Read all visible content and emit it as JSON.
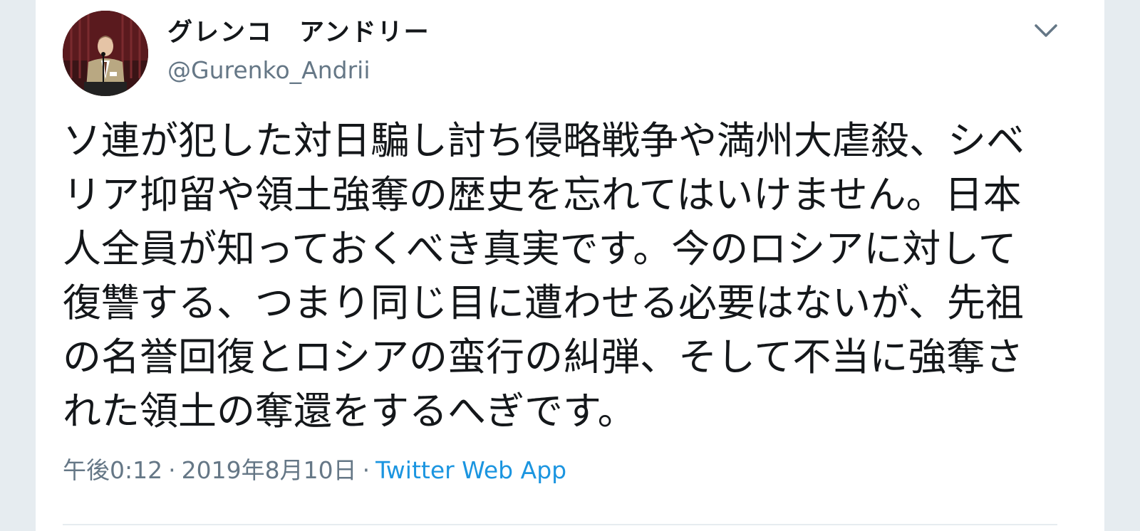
{
  "tweet": {
    "author": {
      "display_name": "グレンコ　アンドリー",
      "handle": "@Gurenko_Andrii"
    },
    "menu_icon": "chevron-down-icon",
    "avatar_icon": "profile-photo",
    "text": "ソ連が犯した対日騙し討ち侵略戦争や満州大虐殺、シベリア抑留や領土強奪の歴史を忘れてはいけません。日本人全員が知っておくべき真実です。今のロシアに対して復讐する、つまり同じ目に遭わせる必要はないが、先祖の名誉回復とロシアの蛮行の糾弾、そして不当に強奪された領土の奪還をするへぎです。",
    "time": "午後0:12",
    "date": "2019年8月10日",
    "separator": "·",
    "source": "Twitter Web App"
  },
  "colors": {
    "background": "#e6ecf0",
    "text_primary": "#14171a",
    "text_secondary": "#657786",
    "link": "#1b95e0"
  }
}
